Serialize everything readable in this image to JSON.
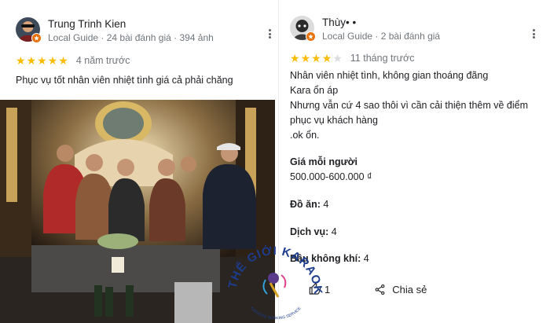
{
  "reviews": [
    {
      "name": "Trung Trinh Kien",
      "meta": "Local Guide · 24 bài đánh giá · 394 ảnh",
      "rating": 5,
      "date": "4 năm trước",
      "text": "Phục vụ tốt nhân viên nhiệt tình giá cả phải chăng"
    },
    {
      "name": "Thùy• •",
      "meta": "Local Guide · 2 bài đánh giá",
      "rating": 4,
      "date": "11 tháng trước",
      "text_lines": [
        "Nhân viên nhiệt tình, không gian thoáng đãng",
        "Kara ổn áp",
        "Nhưng vẫn cứ 4 sao thôi vì cần cải thiện thêm về điểm",
        "phục vụ khách hàng",
        ".ok ổn."
      ],
      "price_label": "Giá mỗi người",
      "price_value": "500.000-600.000 ₫",
      "food_label": "Đồ ăn:",
      "food_value": "4",
      "service_label": "Dịch vụ:",
      "service_value": "4",
      "atmosphere_label": "Bầu không khí:",
      "atmosphere_value": "4",
      "like_count": "1",
      "share_label": "Chia sẻ"
    }
  ],
  "watermark": {
    "main": "THẾ GIỚI KARAOKE",
    "sub": "KARAOKE BOOKING SERVICE"
  },
  "colors": {
    "star": "#fbbc04",
    "star_empty": "#dadce0",
    "local_guide_badge": "#e8710a",
    "secondary_text": "#70757a"
  },
  "icons": [
    "more-vert-icon",
    "star-icon",
    "local-guide-icon",
    "thumb-up-icon",
    "share-icon"
  ]
}
